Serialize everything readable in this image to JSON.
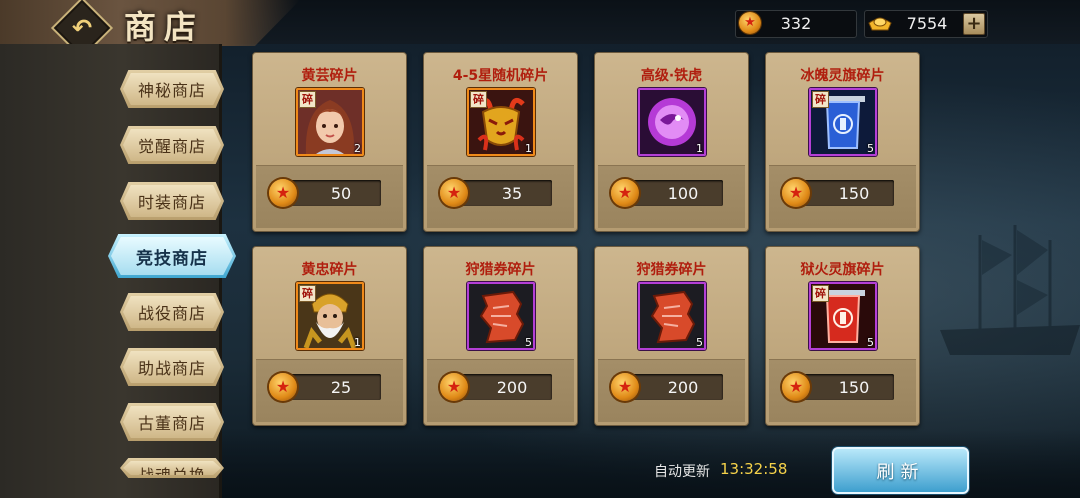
{
  "header": {
    "title": "商店",
    "back_icon": "back-arrow-icon",
    "currencies": [
      {
        "icon": "coin-icon",
        "value": "332"
      },
      {
        "icon": "gold-ingot-icon",
        "value": "7554",
        "add_label": "+"
      }
    ]
  },
  "sidebar": {
    "tabs": [
      {
        "label": "神秘商店"
      },
      {
        "label": "觉醒商店"
      },
      {
        "label": "时装商店"
      },
      {
        "label": "竞技商店",
        "active": true
      },
      {
        "label": "战役商店"
      },
      {
        "label": "助战商店"
      },
      {
        "label": "古董商店"
      },
      {
        "label": "战魂兑换"
      }
    ]
  },
  "shop": {
    "items": [
      {
        "name": "黄芸碎片",
        "count": "2",
        "price": "50",
        "frame": "orange",
        "shard": "碎",
        "icon": "hero-portrait-icon"
      },
      {
        "name": "4-5星随机碎片",
        "count": "1",
        "price": "35",
        "frame": "orange",
        "shard": "碎",
        "icon": "golden-mask-icon"
      },
      {
        "name": "高级·铁虎",
        "count": "1",
        "price": "100",
        "frame": "purple",
        "shard": "",
        "icon": "purple-orb-icon"
      },
      {
        "name": "冰魄灵旗碎片",
        "count": "5",
        "price": "150",
        "frame": "purple",
        "shard": "碎",
        "icon": "blue-banner-icon"
      },
      {
        "name": "黄忠碎片",
        "count": "1",
        "price": "25",
        "frame": "orange",
        "shard": "碎",
        "icon": "old-general-portrait-icon"
      },
      {
        "name": "狩猎券碎片",
        "count": "5",
        "price": "200",
        "frame": "purple",
        "shard": "",
        "icon": "torn-ticket-icon"
      },
      {
        "name": "狩猎券碎片",
        "count": "5",
        "price": "200",
        "frame": "purple",
        "shard": "",
        "icon": "torn-ticket-icon"
      },
      {
        "name": "狱火灵旗碎片",
        "count": "5",
        "price": "150",
        "frame": "purple",
        "shard": "碎",
        "icon": "red-banner-icon"
      }
    ]
  },
  "footer": {
    "auto_refresh_label": "自动更新",
    "auto_refresh_time": "13:32:58",
    "refresh_button_label": "刷新"
  },
  "colors": {
    "item_name": "#b01e0e",
    "timer": "#f5d24a",
    "orange_frame": "#f08a1a",
    "purple_frame": "#b43fd6",
    "refresh_button": "#3e9fce"
  }
}
